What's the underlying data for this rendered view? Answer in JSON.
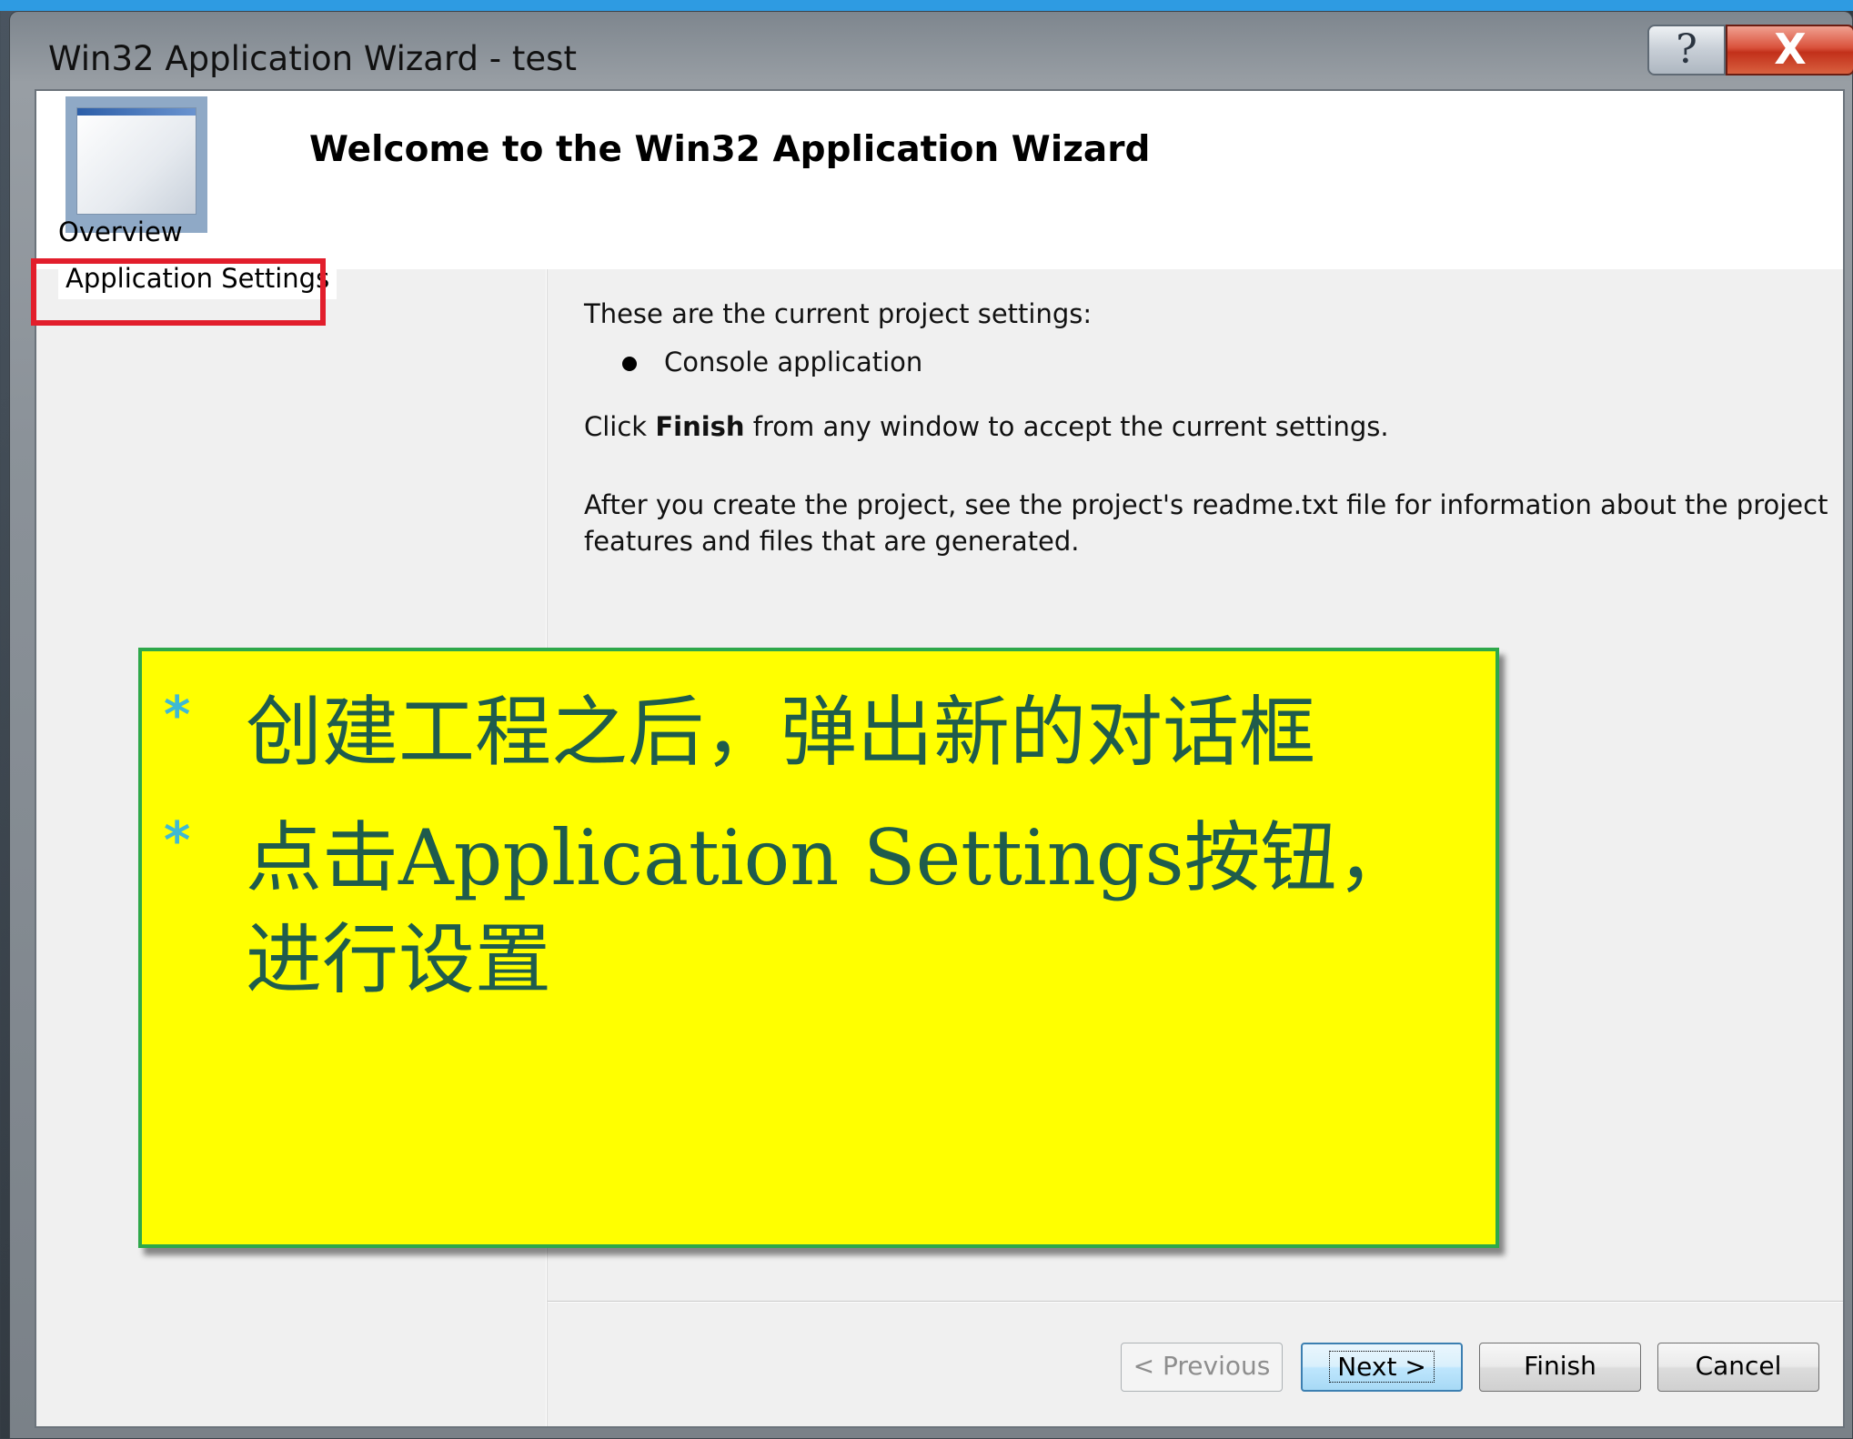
{
  "window": {
    "title": "Win32 Application Wizard - test",
    "help_glyph": "?",
    "close_glyph": "X"
  },
  "header": {
    "title": "Welcome to the Win32 Application Wizard",
    "icon": "window-icon"
  },
  "sidebar": {
    "items": [
      {
        "label": "Overview"
      },
      {
        "label": "Application Settings"
      }
    ]
  },
  "main": {
    "settings_intro": "These are the current project settings:",
    "settings_items": [
      "Console application"
    ],
    "finish_prefix": "Click ",
    "finish_bold": "Finish",
    "finish_suffix": " from any window to accept the current settings.",
    "readme_line1": "After you create the project, see the project's readme.txt file for information about the project",
    "readme_line2": "features and files that are generated."
  },
  "buttons": {
    "previous": "< Previous",
    "next": "Next >",
    "finish": "Finish",
    "cancel": "Cancel"
  },
  "note": {
    "bullet": "*",
    "line1": "创建工程之后，弹出新的对话框",
    "line2": "点击Application Settings按钮，",
    "line3": "进行设置",
    "background_color": "#ffff00",
    "text_color": "#1f5c4c",
    "highlight_color": "#e21e2c"
  }
}
